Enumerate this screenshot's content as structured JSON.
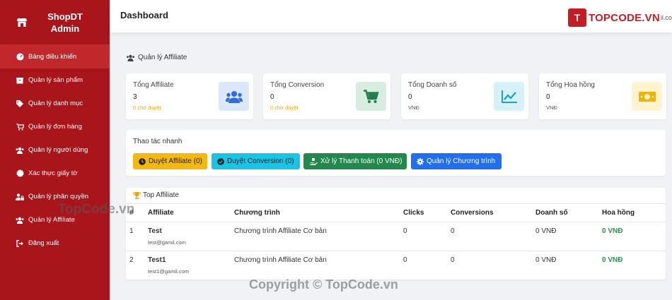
{
  "app": {
    "brand_line1": "ShopDT",
    "brand_line2": "Admin"
  },
  "sidebar": {
    "items": [
      {
        "label": "Bảng điều khiển",
        "icon": "dashboard-icon",
        "active": true
      },
      {
        "label": "Quản lý sản phẩm",
        "icon": "box-icon"
      },
      {
        "label": "Quản lý danh mục",
        "icon": "tag-icon"
      },
      {
        "label": "Quản lý đơn hàng",
        "icon": "cart-icon"
      },
      {
        "label": "Quản lý người dùng",
        "icon": "users-icon"
      },
      {
        "label": "Xác thực giấy tờ",
        "icon": "certificate-icon"
      },
      {
        "label": "Quản lý phân quyền",
        "icon": "user-lock-icon"
      },
      {
        "label": "Quản lý Affiliate",
        "icon": "users-icon"
      },
      {
        "label": "Đăng xuất",
        "icon": "logout-icon"
      }
    ]
  },
  "header": {
    "title": "Dashboard",
    "logo_mark": "T",
    "logo_text": "TOPCODE.VN",
    "logo_suffix": "il.com"
  },
  "section": {
    "title": "Quản lý Affiliate"
  },
  "stats": [
    {
      "label": "Tổng Affiliate",
      "value": "3",
      "sub": "0 chờ duyệt",
      "icon": "users-icon",
      "color": "#2d6cdf",
      "bg": "#dbe7fb"
    },
    {
      "label": "Tổng Conversion",
      "value": "0",
      "sub": "0 chờ duyệt",
      "icon": "cart-icon",
      "color": "#23804a",
      "bg": "#d9ece1"
    },
    {
      "label": "Tổng Doanh số",
      "value": "0",
      "sub": "VNĐ",
      "icon": "chart-line-icon",
      "color": "#17a2c8",
      "bg": "#d6f1f8"
    },
    {
      "label": "Tổng Hoa hồng",
      "value": "0",
      "sub": "VNĐ",
      "icon": "money-icon",
      "color": "#f0b400",
      "bg": "#fdf3cf"
    }
  ],
  "quick": {
    "title": "Thao tác nhanh",
    "buttons": [
      {
        "label": "Duyệt Affiliate (0)",
        "icon": "clock-icon",
        "bg": "#f5b90e",
        "fg": "#222"
      },
      {
        "label": "Duyệt Conversion (0)",
        "icon": "check-circle-icon",
        "bg": "#17c6e6",
        "fg": "#222"
      },
      {
        "label": "Xử lý Thanh toán (0 VNĐ)",
        "icon": "hand-money-icon",
        "bg": "#1f8a4c",
        "fg": "#fff"
      },
      {
        "label": "Quản lý Chương trình",
        "icon": "gear-icon",
        "bg": "#1f6ff0",
        "fg": "#fff"
      }
    ]
  },
  "top_affiliate": {
    "title": "Top Affiliate",
    "columns": [
      "#",
      "Affiliate",
      "Chương trình",
      "Clicks",
      "Conversions",
      "Doanh số",
      "Hoa hồng"
    ],
    "rows": [
      {
        "rank": "1",
        "name": "Test",
        "email": "test@gamil.com",
        "program": "Chương trình Affiliate Cơ bản",
        "clicks": "0",
        "conversions": "0",
        "revenue": "0 VNĐ",
        "commission": "0 VNĐ"
      },
      {
        "rank": "2",
        "name": "Test1",
        "email": "test1@gamil.com",
        "program": "Chương trình Affiliate Cơ bản",
        "clicks": "0",
        "conversions": "0",
        "revenue": "0 VNĐ",
        "commission": "0 VNĐ"
      }
    ]
  },
  "watermarks": {
    "logo": "TopCode.vn",
    "copyright": "Copyright © TopCode.vn"
  }
}
